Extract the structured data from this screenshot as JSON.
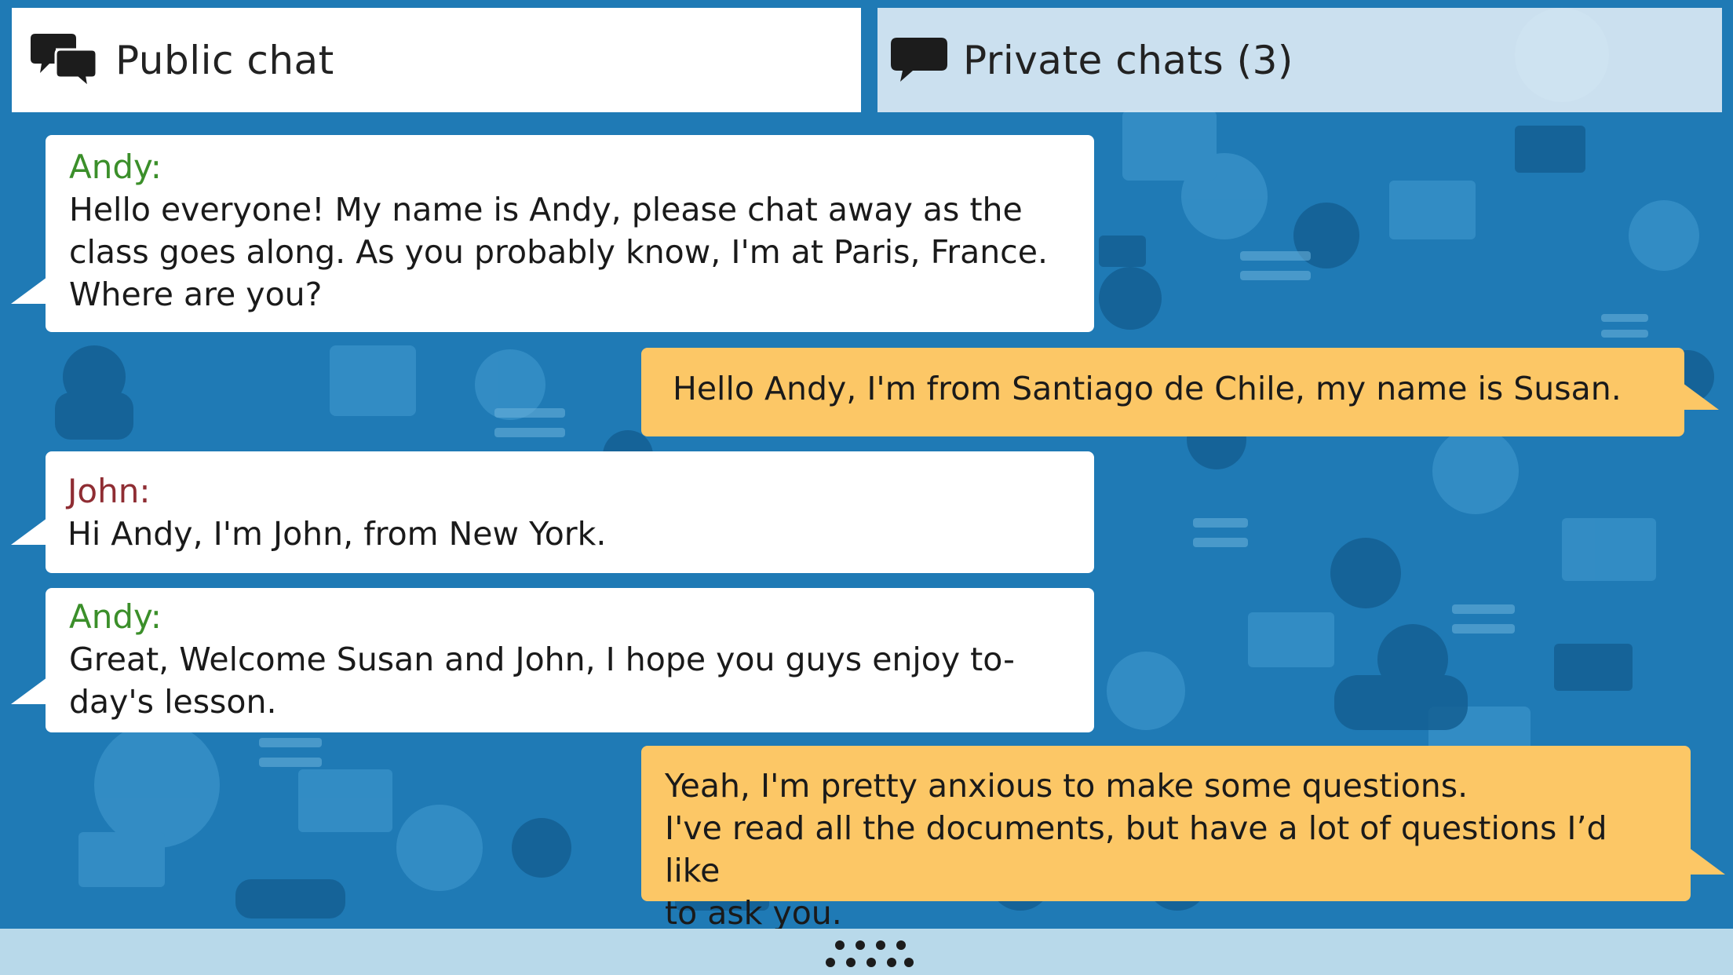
{
  "tabs": {
    "public": {
      "label": "Public chat",
      "icon": "chat-bubbles-icon"
    },
    "private": {
      "label": "Private chats (3)",
      "icon": "chat-bubble-icon"
    }
  },
  "messages": [
    {
      "sender": "Andy:",
      "sender_color": "#3b8f2a",
      "direction": "incoming",
      "lines": [
        "Hello everyone! My name is Andy, please chat away as the",
        "class goes along. As you probably know, I'm at Paris, France.",
        "Where are you?"
      ]
    },
    {
      "sender": "",
      "direction": "outgoing",
      "lines": [
        "Hello Andy, I'm from Santiago de Chile, my name is Susan."
      ]
    },
    {
      "sender": "John:",
      "sender_color": "#8f2d33",
      "direction": "incoming",
      "lines": [
        "Hi Andy, I'm John, from New York."
      ]
    },
    {
      "sender": "Andy:",
      "sender_color": "#3b8f2a",
      "direction": "incoming",
      "lines": [
        "Great, Welcome Susan and John, I hope you guys enjoy to-",
        "day's lesson."
      ]
    },
    {
      "sender": "",
      "direction": "outgoing",
      "lines": [
        "Yeah, I'm pretty anxious to make some questions.",
        "I've read all the documents, but have a lot of questions I’d like",
        "to ask you."
      ]
    }
  ],
  "colors": {
    "background": "#1f7ab5",
    "incoming_bubble": "#ffffff",
    "outgoing_bubble": "#fcc766",
    "bottom_bar": "#b8d9ea"
  },
  "bottom_bar": {
    "handle_icon": "drag-dots-icon"
  }
}
